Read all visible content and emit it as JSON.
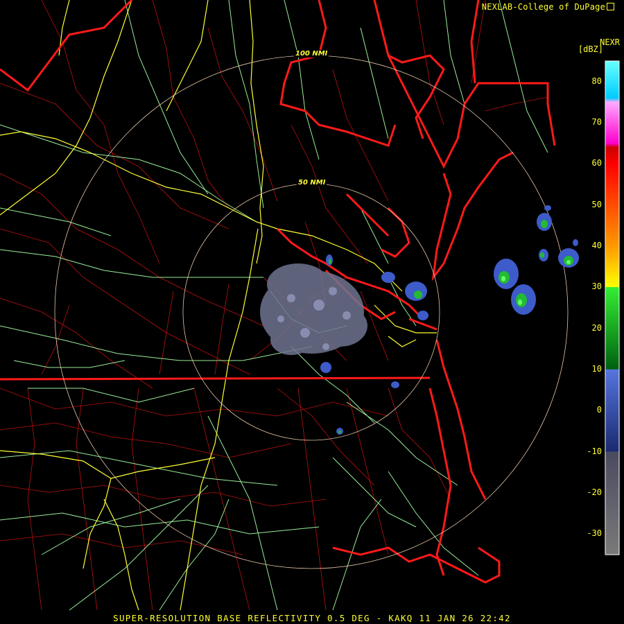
{
  "credit": "NEXLAB-College of DuPage",
  "credit_icon": "external-link-icon",
  "legend": {
    "product": "NEXR",
    "unit": "[dBZ]",
    "ticks": [
      80,
      70,
      60,
      50,
      40,
      30,
      20,
      10,
      0,
      -10,
      -20,
      -30
    ],
    "range": [
      -35,
      85
    ],
    "stops": [
      {
        "dbz": -35,
        "color": "#7a7a7a"
      },
      {
        "dbz": -10,
        "color": "#4a4a60"
      },
      {
        "dbz": -9.9,
        "color": "#1a2a70"
      },
      {
        "dbz": 10,
        "color": "#5575dd"
      },
      {
        "dbz": 10.1,
        "color": "#006010"
      },
      {
        "dbz": 30,
        "color": "#33ee33"
      },
      {
        "dbz": 30.1,
        "color": "#ffff00"
      },
      {
        "dbz": 40,
        "color": "#ff9900"
      },
      {
        "dbz": 60,
        "color": "#ff0000"
      },
      {
        "dbz": 64,
        "color": "#cc0000"
      },
      {
        "dbz": 65,
        "color": "#ff00cc"
      },
      {
        "dbz": 75,
        "color": "#ffaaff"
      },
      {
        "dbz": 76,
        "color": "#00ccff"
      },
      {
        "dbz": 85,
        "color": "#66ffff"
      }
    ]
  },
  "rings": [
    {
      "label": "100 NMI",
      "nmi": 100
    },
    {
      "label": "50 NMI",
      "nmi": 50
    }
  ],
  "footer": "SUPER-RESOLUTION BASE REFLECTIVITY 0.5 DEG - KAKQ 11 JAN 26 22:42",
  "colors": {
    "state_border": "#ff1a1a",
    "county_border": "#bb1111",
    "interstate": "#ffff33",
    "highway": "#99ee99",
    "ring": "#e8c8a8",
    "text": "#ffff33"
  }
}
